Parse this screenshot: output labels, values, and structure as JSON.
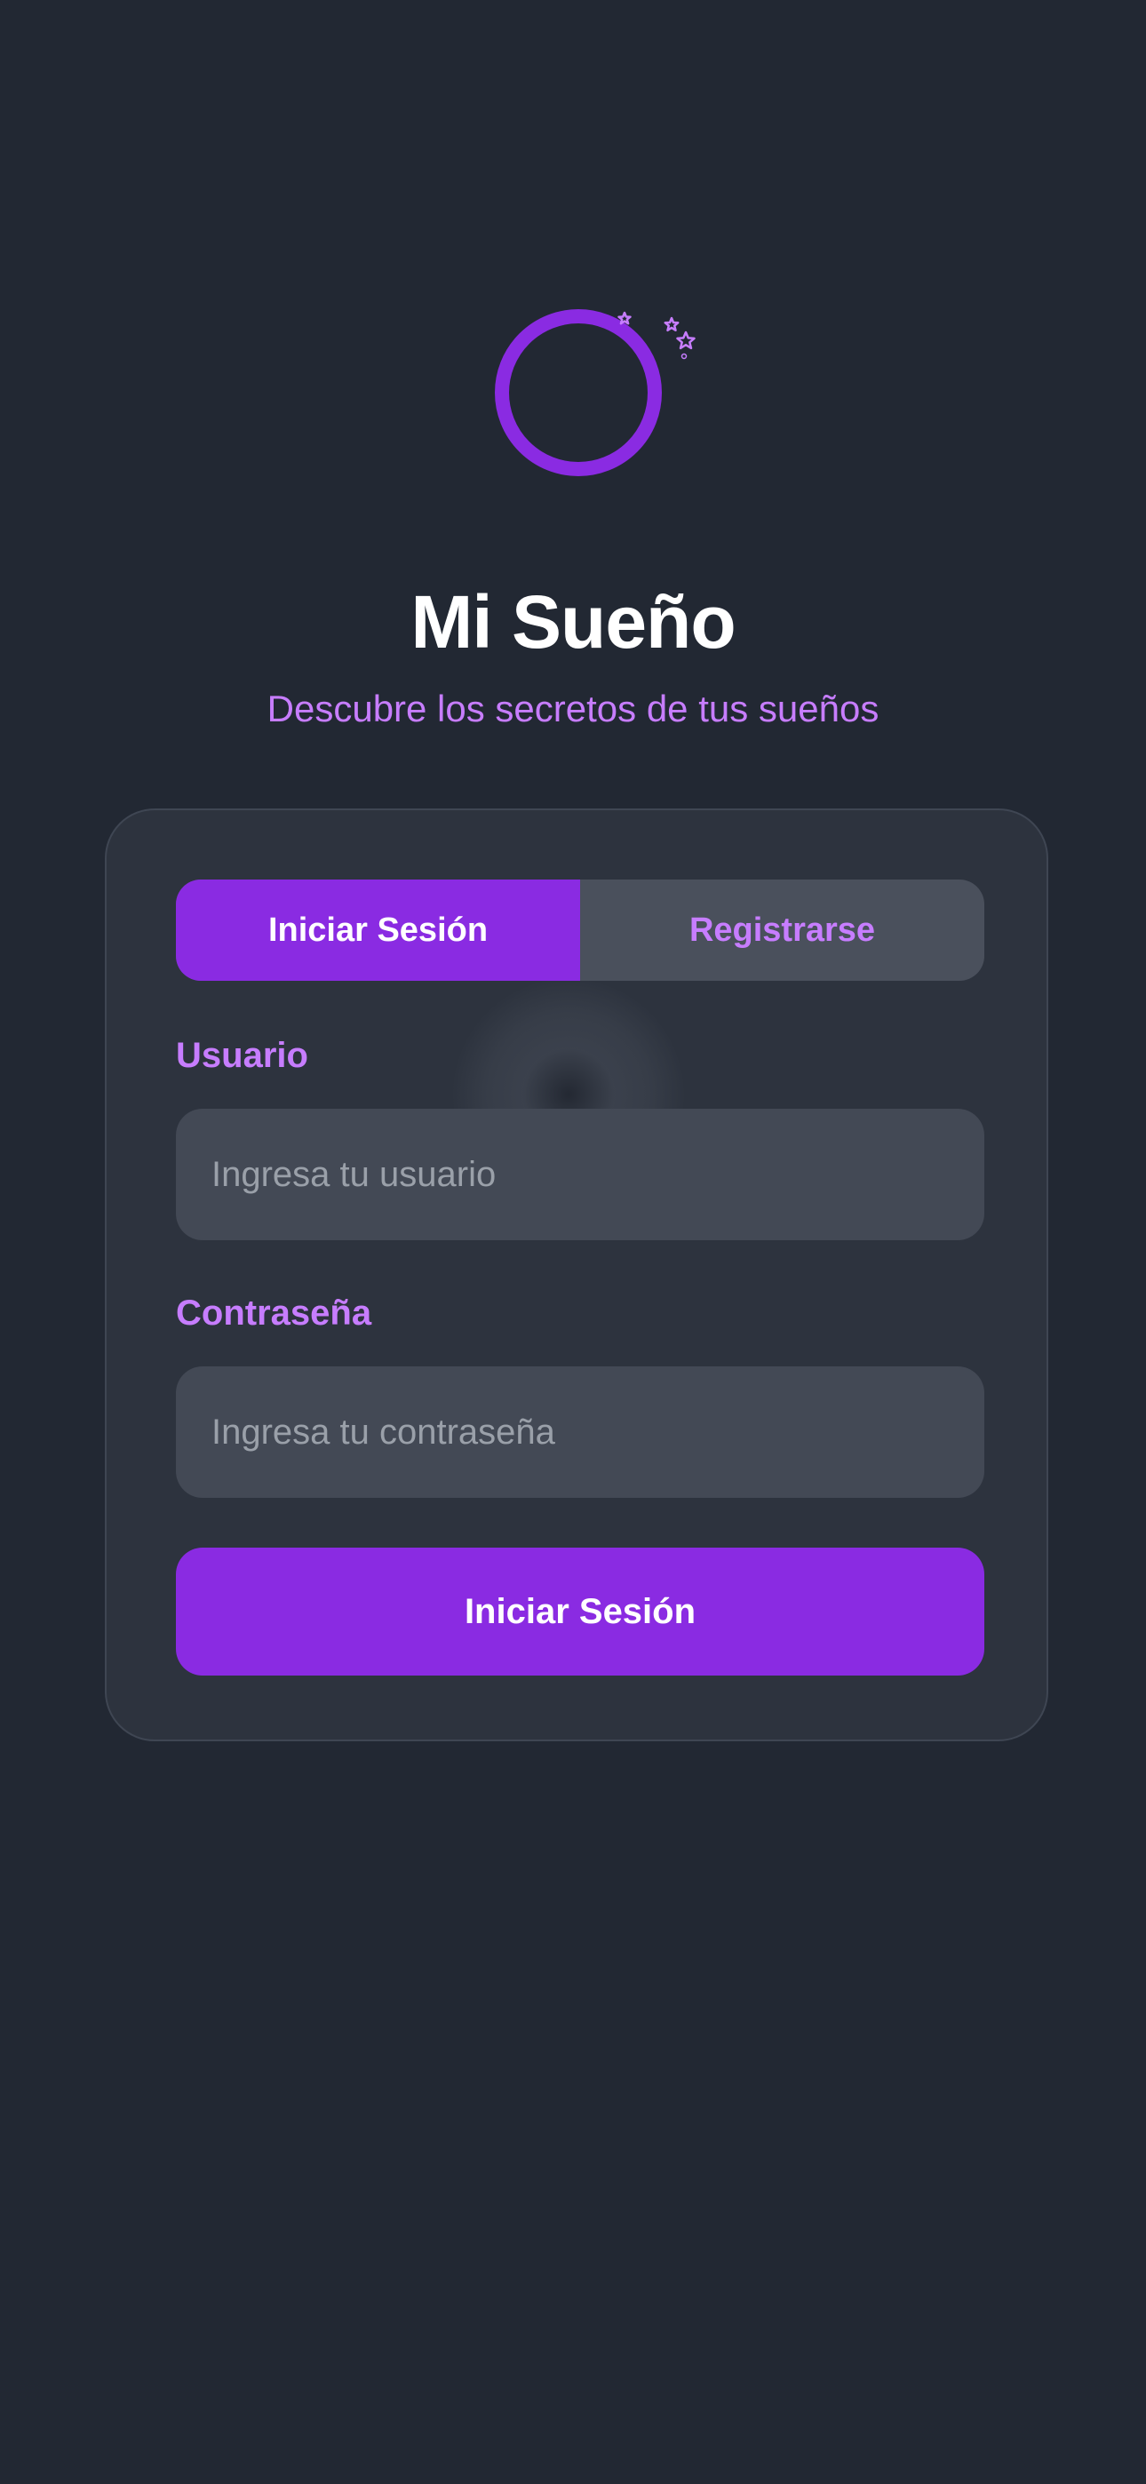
{
  "app": {
    "title": "Mi Sueño",
    "subtitle": "Descubre los secretos de tus sueños"
  },
  "logo": {
    "icon": "moon-ring-with-stars-icon",
    "color": "#8a2be2"
  },
  "auth": {
    "tabs": [
      {
        "label": "Iniciar Sesión",
        "active": true
      },
      {
        "label": "Registrarse",
        "active": false
      }
    ],
    "username": {
      "label": "Usuario",
      "placeholder": "Ingresa tu usuario",
      "value": ""
    },
    "password": {
      "label": "Contraseña",
      "placeholder": "Ingresa tu contraseña",
      "value": ""
    },
    "submit_label": "Iniciar Sesión"
  },
  "colors": {
    "background": "#222833",
    "card": "#2d333e",
    "accent": "#8a2be2",
    "accent_text": "#c77dff"
  }
}
